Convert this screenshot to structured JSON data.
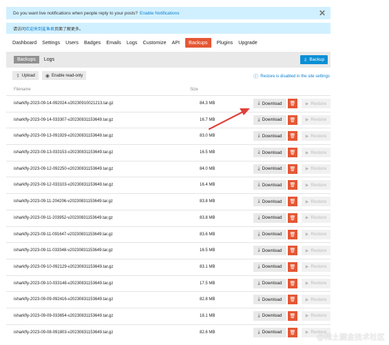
{
  "notification": {
    "text": "Do you want live notifications when people reply to your posts?",
    "link": "Enable Notifications",
    "close": "✕"
  },
  "welcome": {
    "prefix": "请访问",
    "link": "欢迎来到鲨鱼君",
    "suffix": "页面了解更多。"
  },
  "nav": {
    "items": [
      "Dashboard",
      "Settings",
      "Users",
      "Badges",
      "Emails",
      "Logs",
      "Customize",
      "API",
      "Backups",
      "Plugins",
      "Upgrade"
    ],
    "active_index": 8
  },
  "subtabs": {
    "backups": "Backups",
    "logs": "Logs"
  },
  "backup_button": "Backup",
  "actions": {
    "upload": "Upload",
    "read_only": "Enable read-only"
  },
  "restore_note": "Restore is disabled in the site settings",
  "columns": {
    "filename": "Filename",
    "size": "Size"
  },
  "row_labels": {
    "download": "Download",
    "restore": "Restore"
  },
  "rows": [
    {
      "filename": "isharkfly-2023-09-14-092024-v20230910021213.tar.gz",
      "size": "84.3 MB"
    },
    {
      "filename": "isharkfly-2023-09-14-033307-v20230831153649.tar.gz",
      "size": "16.7 MB"
    },
    {
      "filename": "isharkfly-2023-09-13-091929-v20230831153649.tar.gz",
      "size": "83.0 MB"
    },
    {
      "filename": "isharkfly-2023-09-13-033153-v20230831153649.tar.gz",
      "size": "16.5 MB"
    },
    {
      "filename": "isharkfly-2023-09-12-092250-v20230831153649.tar.gz",
      "size": "84.0 MB"
    },
    {
      "filename": "isharkfly-2023-09-12-033103-v20230831153649.tar.gz",
      "size": "16.4 MB"
    },
    {
      "filename": "isharkfly-2023-09-11-204206-v20230831153649.tar.gz",
      "size": "83.8 MB"
    },
    {
      "filename": "isharkfly-2023-09-11-203952-v20230831153649.tar.gz",
      "size": "83.8 MB"
    },
    {
      "filename": "isharkfly-2023-09-11-091647-v20230831153649.tar.gz",
      "size": "83.6 MB"
    },
    {
      "filename": "isharkfly-2023-09-11-033348-v20230831153649.tar.gz",
      "size": "16.5 MB"
    },
    {
      "filename": "isharkfly-2023-09-10-092129-v20230831153649.tar.gz",
      "size": "83.1 MB"
    },
    {
      "filename": "isharkfly-2023-09-10-033148-v20230831153649.tar.gz",
      "size": "17.5 MB"
    },
    {
      "filename": "isharkfly-2023-09-09-092416-v20230831153649.tar.gz",
      "size": "82.8 MB"
    },
    {
      "filename": "isharkfly-2023-09-09-033654-v20230831153649.tar.gz",
      "size": "18.1 MB"
    },
    {
      "filename": "isharkfly-2023-09-08-091803-v20230831153649.tar.gz",
      "size": "82.6 MB"
    }
  ],
  "watermark": "@稀土掘金技术社区",
  "colors": {
    "accent": "#e45735",
    "link": "#0a7fcc",
    "banner": "#d1f0ff",
    "arrow": "#e0403a"
  },
  "icons": {
    "upload": "upload-icon",
    "read_only": "eye-icon",
    "download": "download-icon",
    "delete": "trash-icon",
    "restore": "play-icon",
    "info": "info-icon"
  }
}
